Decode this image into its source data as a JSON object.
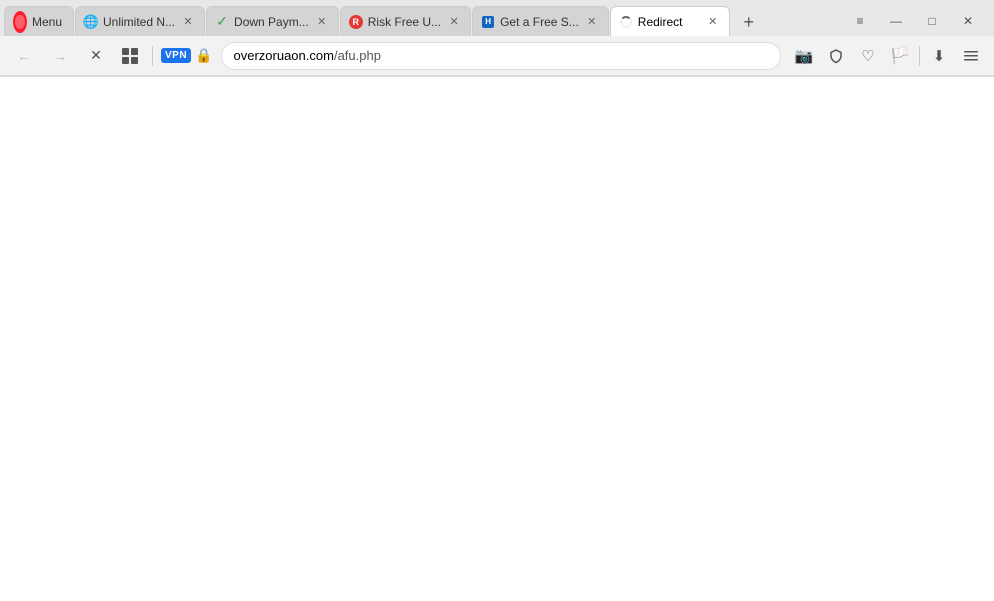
{
  "browser": {
    "title": "Redirect"
  },
  "tabs": [
    {
      "id": "tab-1",
      "favicon_type": "opera",
      "favicon_label": "O",
      "title": "Menu",
      "closable": false,
      "active": false
    },
    {
      "id": "tab-2",
      "favicon_type": "globe",
      "favicon_label": "🌐",
      "title": "Unlimited N...",
      "closable": true,
      "active": false
    },
    {
      "id": "tab-3",
      "favicon_type": "green-check",
      "favicon_label": "✓",
      "title": "Down Paym...",
      "closable": true,
      "active": false
    },
    {
      "id": "tab-4",
      "favicon_type": "red-r",
      "favicon_label": "R",
      "title": "Risk Free U...",
      "closable": true,
      "active": false
    },
    {
      "id": "tab-5",
      "favicon_type": "blue-h",
      "favicon_label": "H",
      "title": "Get a Free S...",
      "closable": true,
      "active": false
    },
    {
      "id": "tab-6",
      "favicon_type": "spinner",
      "favicon_label": "",
      "title": "Redirect",
      "closable": true,
      "active": true
    }
  ],
  "address_bar": {
    "domain": "overzoruaon.com",
    "path": "/afu.php",
    "full_url": "overzoruaon.com/afu.php"
  },
  "toolbar": {
    "back_label": "←",
    "forward_label": "→",
    "stop_label": "✕",
    "tab_list_label": "⊞",
    "vpn_label": "VPN",
    "new_tab_label": "+"
  },
  "window_controls": {
    "tab_list": "≡",
    "minimize": "—",
    "maximize": "□",
    "close": "✕"
  },
  "page": {
    "content": ""
  }
}
